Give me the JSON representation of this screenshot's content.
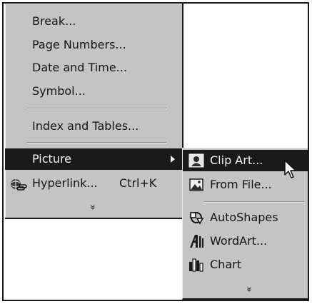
{
  "insert_menu": {
    "items": [
      {
        "label": "Break..."
      },
      {
        "label": "Page Numbers..."
      },
      {
        "label": "Date and Time..."
      },
      {
        "label": "Symbol..."
      },
      {
        "label": "Index and Tables..."
      },
      {
        "label": "Picture"
      },
      {
        "label": "Hyperlink...",
        "shortcut": "Ctrl+K"
      }
    ],
    "expand_glyph": "»"
  },
  "picture_submenu": {
    "items": [
      {
        "label": "Clip Art...",
        "icon": "clip-art-icon"
      },
      {
        "label": "From File...",
        "icon": "from-file-icon"
      },
      {
        "label": "AutoShapes",
        "icon": "autoshapes-icon"
      },
      {
        "label": "WordArt...",
        "icon": "wordart-icon"
      },
      {
        "label": "Chart",
        "icon": "chart-icon"
      }
    ],
    "expand_glyph": "»"
  },
  "colors": {
    "menu_bg": "#c4c4c4",
    "highlight": "#1a1a1a",
    "highlight_text": "#f4f4f4"
  }
}
